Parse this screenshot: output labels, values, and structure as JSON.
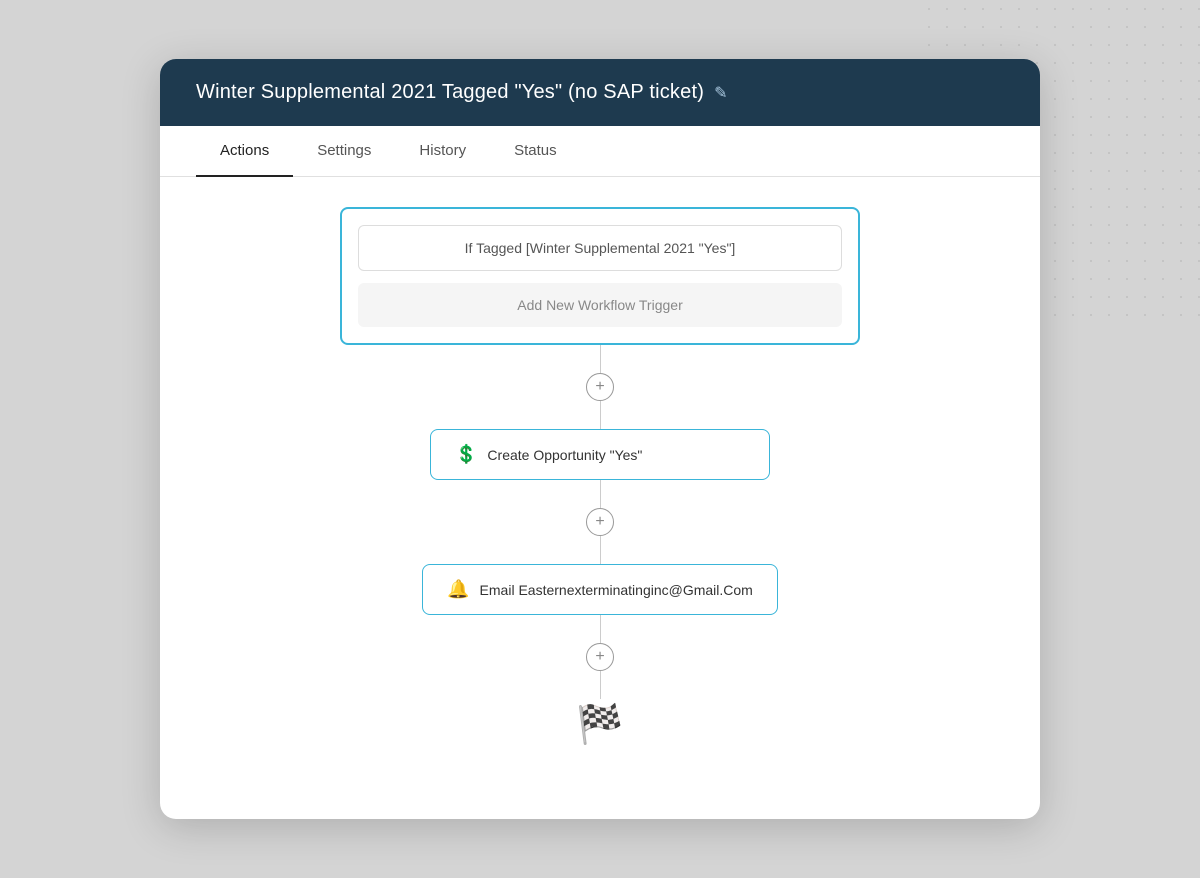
{
  "header": {
    "title": "Winter Supplemental 2021 Tagged \"Yes\" (no SAP ticket)",
    "edit_icon": "✎"
  },
  "tabs": [
    {
      "id": "actions",
      "label": "Actions",
      "active": true
    },
    {
      "id": "settings",
      "label": "Settings",
      "active": false
    },
    {
      "id": "history",
      "label": "History",
      "active": false
    },
    {
      "id": "status",
      "label": "Status",
      "active": false
    }
  ],
  "trigger_box": {
    "condition_label": "If Tagged [Winter Supplemental 2021 \"Yes\"]",
    "add_trigger_label": "Add New Workflow Trigger"
  },
  "actions": [
    {
      "id": "create-opportunity",
      "icon": "💲",
      "label": "Create Opportunity \"Yes\""
    },
    {
      "id": "email-action",
      "icon": "🔔",
      "label": "Email Easternexterminatinginc@Gmail.Com"
    }
  ],
  "connectors": {
    "plus_symbol": "+"
  },
  "finish": {
    "icon": "🏁"
  },
  "colors": {
    "accent_blue": "#3ab5d9",
    "header_dark": "#1e3a4f",
    "green_icon": "#2a9d5c"
  }
}
